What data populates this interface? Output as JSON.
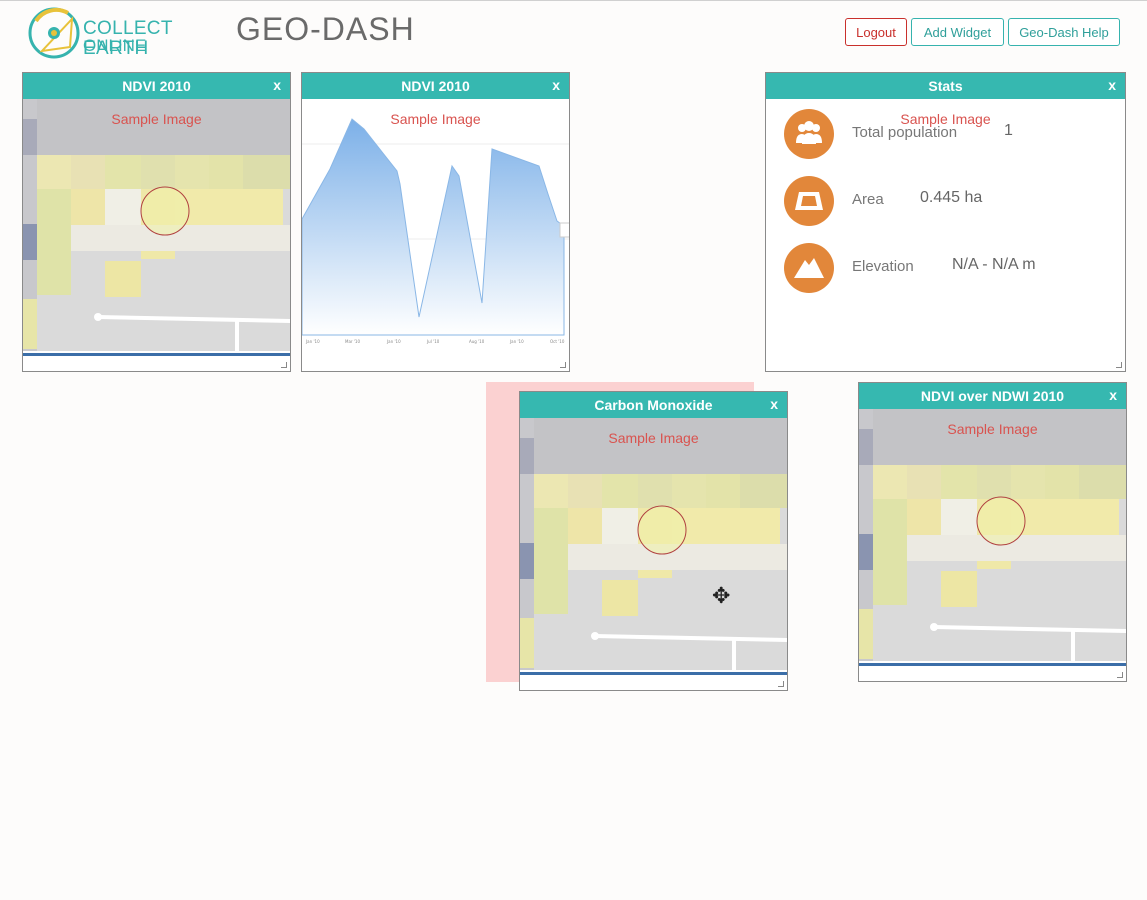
{
  "header": {
    "logo_line1": "COLLECT EARTH",
    "logo_line2": "ONLINE",
    "app_title": "GEO-DASH",
    "buttons": {
      "logout": "Logout",
      "add_widget": "Add Widget",
      "help": "Geo-Dash Help"
    }
  },
  "colors": {
    "accent": "#36b8b0",
    "danger": "#c9302c",
    "stat_icon": "#e2873a",
    "bar": "#3b6ea8"
  },
  "widgets": {
    "ndvi_map": {
      "title": "NDVI 2010",
      "close": "x",
      "sample": "Sample Image"
    },
    "ndvi_chart": {
      "title": "NDVI 2010",
      "close": "x",
      "sample": "Sample Image",
      "x_ticks": [
        "Jan '10",
        "Mar '10",
        "Jan '10",
        "Jul '10",
        "Aug '10",
        "Jan '10",
        "Oct '10"
      ]
    },
    "stats": {
      "title": "Stats",
      "close": "x",
      "sample": "Sample Image",
      "rows": [
        {
          "icon": "population-icon",
          "label": "Total population",
          "value": "1"
        },
        {
          "icon": "area-icon",
          "label": "Area",
          "value": "0.445 ha"
        },
        {
          "icon": "elevation-icon",
          "label": "Elevation",
          "value": "N/A - N/A m"
        }
      ]
    },
    "carbon": {
      "title": "Carbon Monoxide",
      "close": "x",
      "sample": "Sample Image"
    },
    "ndvi_ndwi": {
      "title": "NDVI over NDWI 2010",
      "close": "x",
      "sample": "Sample Image"
    }
  }
}
